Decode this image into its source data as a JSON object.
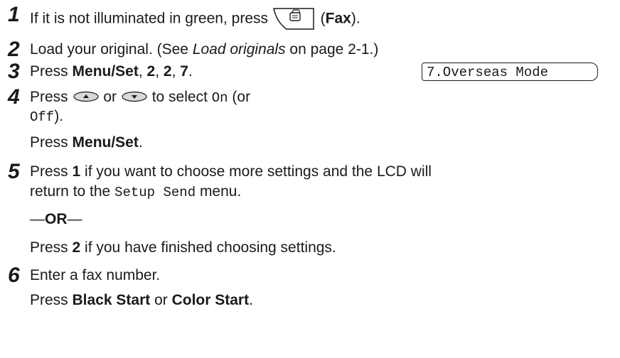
{
  "steps": [
    {
      "number": "1",
      "text_before": "If it is not illuminated in green, press ",
      "key_icon": "fax-key-icon",
      "text_paren_open": " (",
      "key_name": "Fax",
      "text_paren_close": ")."
    },
    {
      "number": "2",
      "text_before": "Load your original. (See ",
      "link_text": "Load originals",
      "text_after": " on page 2-1.)"
    },
    {
      "number": "3",
      "press": "Press ",
      "menu_set": "Menu/Set",
      "sep1": ", ",
      "k1": "2",
      "sep2": ", ",
      "k2": "2",
      "sep3": ", ",
      "k3": "7",
      "end": "."
    },
    {
      "number": "4",
      "press": "Press ",
      "up_icon": "up-arrow-key-icon",
      "or": " or ",
      "down_icon": "down-arrow-key-icon",
      "to_select": " to select ",
      "on_value": "On",
      "or_paren": " (or",
      "off_value": "Off",
      "close_paren": ").",
      "press2": "Press ",
      "menu_set": "Menu/Set",
      "period": "."
    },
    {
      "number": "5",
      "press": "Press ",
      "key1": "1",
      "text1": " if you want to choose more settings and the LCD will",
      "text2": "return to the ",
      "menu_name": "Setup Send",
      "text3": " menu.",
      "dash_open": "—",
      "or_word": "OR",
      "dash_close": "—",
      "press2": "Press ",
      "key2": "2",
      "text4": " if you have finished choosing settings."
    },
    {
      "number": "6",
      "text1": "Enter a fax number.",
      "press": "Press ",
      "black_start": "Black Start",
      "or": " or ",
      "color_start": "Color Start",
      "period": "."
    }
  ],
  "lcd": {
    "text": "7.Overseas Mode"
  }
}
